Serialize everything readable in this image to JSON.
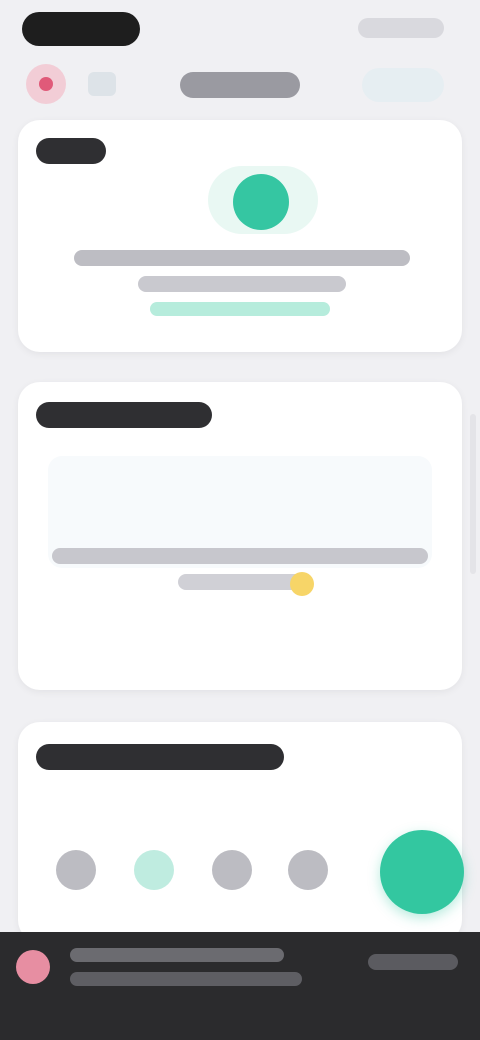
{
  "status_bar": {},
  "top_bar": {},
  "cards": [
    {
      "title": ""
    },
    {
      "title": ""
    },
    {
      "title": ""
    }
  ],
  "tab_bar": {
    "items": [
      {
        "icon": "tab-icon-1"
      },
      {
        "icon": "tab-icon-2",
        "active": true
      },
      {
        "icon": "tab-icon-3"
      },
      {
        "icon": "tab-icon-4"
      }
    ],
    "fab": {
      "icon": "add-icon"
    }
  },
  "banner": {},
  "colors": {
    "accent": "#33c7a0",
    "brand_pink": "#e05a79",
    "banner_bg": "#2b2b2d",
    "page_bg": "#f0f0f3"
  }
}
